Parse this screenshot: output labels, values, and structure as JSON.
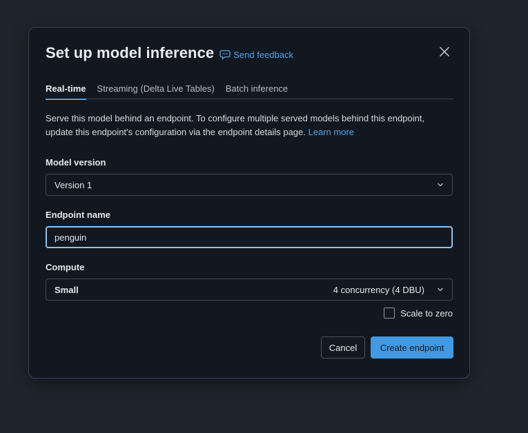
{
  "modal": {
    "title": "Set up model inference",
    "feedback_label": "Send feedback"
  },
  "tabs": [
    {
      "label": "Real-time",
      "active": true
    },
    {
      "label": "Streaming (Delta Live Tables)",
      "active": false
    },
    {
      "label": "Batch inference",
      "active": false
    }
  ],
  "description": {
    "text": "Serve this model behind an endpoint. To configure multiple served models behind this endpoint, update this endpoint's configuration via the endpoint details page.",
    "link": "Learn more"
  },
  "model_version": {
    "label": "Model version",
    "value": "Version 1"
  },
  "endpoint_name": {
    "label": "Endpoint name",
    "value": "penguin"
  },
  "compute": {
    "label": "Compute",
    "size": "Small",
    "detail": "4 concurrency (4 DBU)"
  },
  "scale_to_zero": {
    "label": "Scale to zero",
    "checked": false
  },
  "buttons": {
    "cancel": "Cancel",
    "create": "Create endpoint"
  },
  "colors": {
    "accent": "#4299e1",
    "link": "#4ea3e8",
    "background": "#131820"
  },
  "icons": {
    "feedback": "speech-bubble-icon",
    "close": "close-icon",
    "dropdown": "chevron-down-icon"
  }
}
